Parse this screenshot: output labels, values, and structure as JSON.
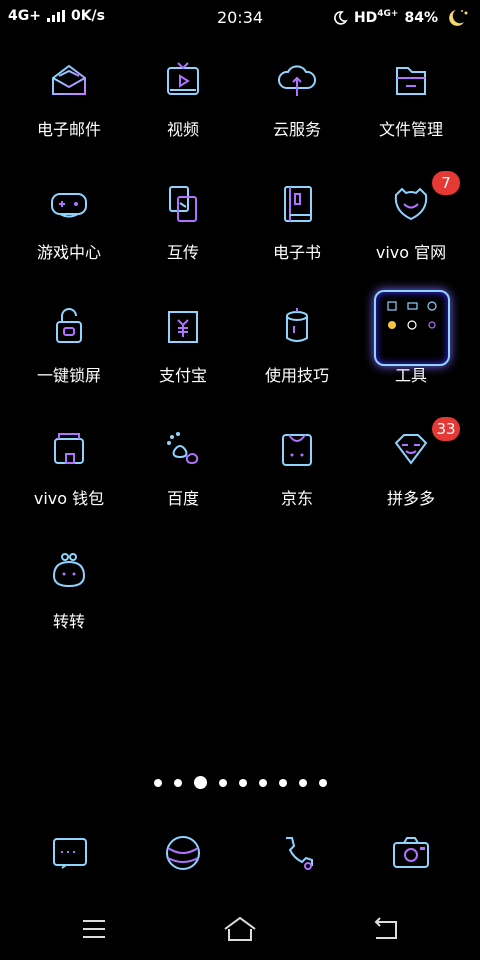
{
  "status": {
    "network": "4G+",
    "speed": "0K/s",
    "time": "20:34",
    "hd": "HD",
    "hd_sup": "4G+",
    "battery": "84%"
  },
  "apps": [
    {
      "label": "电子邮件",
      "icon": "mail-icon"
    },
    {
      "label": "视频",
      "icon": "video-icon"
    },
    {
      "label": "云服务",
      "icon": "cloud-icon"
    },
    {
      "label": "文件管理",
      "icon": "folder-icon"
    },
    {
      "label": "游戏中心",
      "icon": "gamepad-icon"
    },
    {
      "label": "互传",
      "icon": "transfer-icon"
    },
    {
      "label": "电子书",
      "icon": "book-icon"
    },
    {
      "label": "vivo 官网",
      "icon": "smile-icon",
      "badge": "7"
    },
    {
      "label": "一键锁屏",
      "icon": "lock-icon"
    },
    {
      "label": "支付宝",
      "icon": "alipay-icon"
    },
    {
      "label": "使用技巧",
      "icon": "tips-icon"
    },
    {
      "label": "工具",
      "icon": "tools-folder-icon"
    },
    {
      "label": "vivo 钱包",
      "icon": "wallet-icon"
    },
    {
      "label": "百度",
      "icon": "baidu-icon"
    },
    {
      "label": "京东",
      "icon": "jd-icon"
    },
    {
      "label": "拼多多",
      "icon": "pinduoduo-icon",
      "badge": "33"
    },
    {
      "label": "转转",
      "icon": "zhuanzhuan-icon"
    }
  ],
  "pager": {
    "count": 9,
    "active": 2
  },
  "dock": [
    {
      "icon": "messages-icon"
    },
    {
      "icon": "browser-icon"
    },
    {
      "icon": "phone-icon"
    },
    {
      "icon": "camera-icon"
    }
  ],
  "nav": [
    {
      "icon": "menu-icon"
    },
    {
      "icon": "home-icon"
    },
    {
      "icon": "back-icon"
    }
  ],
  "colors": {
    "glow_blue": "#8fd3ff",
    "glow_purple": "#b073ff",
    "badge": "#e53935"
  }
}
